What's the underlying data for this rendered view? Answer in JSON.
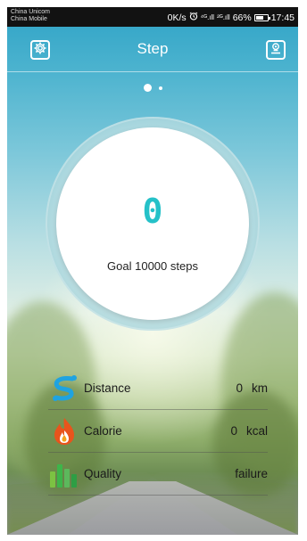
{
  "status_bar": {
    "carrier_1": "China Unicom",
    "carrier_2": "China Mobile",
    "speed": "0K/s",
    "signal_1": "⁴ᴳ.ıll",
    "signal_2": "²ᴳ.ıll",
    "battery": "66%",
    "time": "17:45"
  },
  "header": {
    "title": "Step",
    "left_icon": "gear-icon",
    "right_icon": "profile-icon"
  },
  "pager": {
    "pages": 2,
    "active": 0
  },
  "steps": {
    "value": "0",
    "goal_label": "Goal 10000 steps"
  },
  "stats": [
    {
      "icon": "distance-icon",
      "label": "Distance",
      "value": "0",
      "unit": "km"
    },
    {
      "icon": "calorie-icon",
      "label": "Calorie",
      "value": "0",
      "unit": "kcal"
    },
    {
      "icon": "quality-icon",
      "label": "Quality",
      "value": "failure",
      "unit": ""
    }
  ],
  "colors": {
    "accent": "#25c1c8",
    "distance": "#1fa3e0",
    "calorie": "#e8541c",
    "quality": "#3db54a"
  }
}
